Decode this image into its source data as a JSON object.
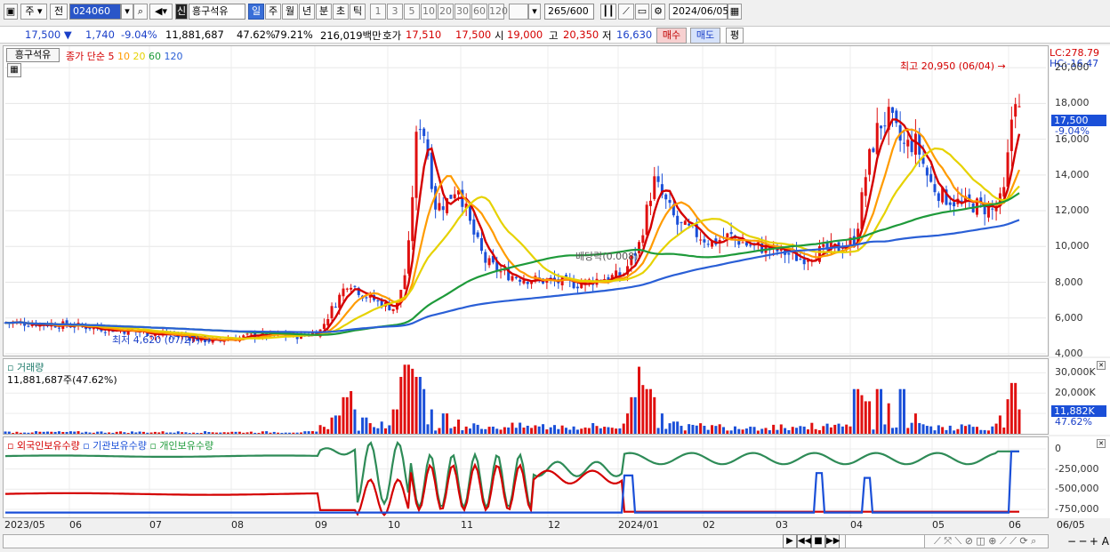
{
  "toolbar": {
    "period_label": "주",
    "prev_label": "전",
    "code_value": "024060",
    "stock_badge": "신",
    "stock_name": "흥구석유",
    "tabs": [
      "일",
      "주",
      "월",
      "년",
      "분",
      "초",
      "틱"
    ],
    "active_tab": "일",
    "intervals": [
      "1",
      "3",
      "5",
      "10",
      "20",
      "30",
      "60",
      "120"
    ],
    "count_value": "265",
    "count_total": "/600",
    "date_value": "2024/06/05"
  },
  "quote": {
    "price": "17,500",
    "change": "1,740",
    "change_rate": "-9.04%",
    "volume": "11,881,687",
    "volume_rate": "47.62%",
    "ratio2": "79.21%",
    "amount": "216,019백만",
    "bid_label": "호가",
    "bid1": "17,510",
    "bid2": "17,500",
    "open_label": "시",
    "open": "19,000",
    "high_label": "고",
    "high": "20,350",
    "low_label": "저",
    "low": "16,630",
    "buy_label": "매수",
    "sell_label": "매도",
    "eval_label": "평"
  },
  "price_panel": {
    "name": "흥구석유",
    "ma_legend": "종가 단순",
    "ma_periods": [
      {
        "label": "5",
        "color": "#d40000"
      },
      {
        "label": "10",
        "color": "#ff9b00"
      },
      {
        "label": "20",
        "color": "#e6d200"
      },
      {
        "label": "60",
        "color": "#1e9a3a"
      },
      {
        "label": "120",
        "color": "#2a5fd6"
      }
    ],
    "lc_label": "LC:278.79",
    "hc_label": "HC:-16.47",
    "high_note": "최고 20,950 (06/04)",
    "low_note": "최저 4,620 (07/27)",
    "event_note": "배당락(0.008)",
    "current_price": "17,500",
    "current_change": "-9.04%",
    "y_ticks": [
      "20,000",
      "18,000",
      "16,000",
      "14,000",
      "12,000",
      "10,000",
      "8,000",
      "6,000",
      "4,000"
    ]
  },
  "volume_panel": {
    "title": "거래량",
    "value": "11,881,687주(47.62%)",
    "current": "11,882K",
    "current_rate": "47.62%",
    "y_ticks": [
      "30,000K",
      "20,000K",
      "10,000K"
    ]
  },
  "holder_panel": {
    "legend": [
      "외국인보유수량",
      "기관보유수량",
      "개인보유수량"
    ],
    "y_ticks": [
      "0",
      "-250,000",
      "-500,000",
      "-750,000"
    ]
  },
  "x_axis": [
    "2023/05",
    "06",
    "07",
    "08",
    "09",
    "10",
    "11",
    "12",
    "2024/01",
    "02",
    "03",
    "04",
    "05",
    "06",
    "06/05"
  ],
  "chart_data": {
    "type": "candlestick",
    "x_range": [
      "2023/05",
      "2024/06/05"
    ],
    "price_axis": {
      "ylim": [
        4000,
        21000
      ],
      "ticks": [
        4000,
        6000,
        8000,
        10000,
        12000,
        14000,
        16000,
        18000,
        20000
      ]
    },
    "price_series": [
      {
        "date": "2023/05",
        "close": 5700
      },
      {
        "date": "2023/06",
        "close": 5600
      },
      {
        "date": "2023/07",
        "close": 5200
      },
      {
        "date": "2023/07/27",
        "close": 4620
      },
      {
        "date": "2023/08",
        "close": 5000
      },
      {
        "date": "2023/09",
        "close": 5400
      },
      {
        "date": "2023/09 mid",
        "close": 7800
      },
      {
        "date": "2023/10 early",
        "close": 6600
      },
      {
        "date": "2023/10 mid",
        "close": 17800
      },
      {
        "date": "2023/10 late",
        "close": 12000
      },
      {
        "date": "2023/11",
        "close": 13500
      },
      {
        "date": "2023/11 late",
        "close": 8700
      },
      {
        "date": "2023/12",
        "close": 8000
      },
      {
        "date": "2024/01 early",
        "close": 8400
      },
      {
        "date": "2024/01 mid",
        "close": 14000
      },
      {
        "date": "2024/02",
        "close": 10500
      },
      {
        "date": "2024/03",
        "close": 9400
      },
      {
        "date": "2024/04 early",
        "close": 10300
      },
      {
        "date": "2024/04 mid",
        "close": 18500
      },
      {
        "date": "2024/05",
        "close": 13500
      },
      {
        "date": "2024/05 late",
        "close": 12200
      },
      {
        "date": "2024/06/04",
        "close": 19000
      },
      {
        "date": "2024/06/05",
        "close": 17500
      }
    ],
    "high": {
      "value": 20950,
      "date": "06/04"
    },
    "low": {
      "value": 4620,
      "date": "07/27"
    },
    "volume_axis": {
      "ylim": [
        0,
        35000
      ],
      "unit": "K",
      "ticks": [
        10000,
        20000,
        30000
      ]
    },
    "volume_current_k": 11882,
    "holder_axis": {
      "ylim": [
        -850000,
        100000
      ],
      "ticks": [
        0,
        -250000,
        -500000,
        -750000
      ]
    }
  }
}
